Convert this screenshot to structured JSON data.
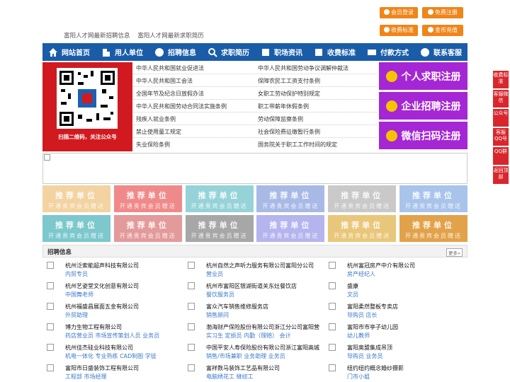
{
  "header": {
    "links": [
      "富阳人才网最新招聘信息",
      "富阳人才网最新求职简历"
    ],
    "buttons": [
      "会员登录",
      "免费注册",
      "收费标准",
      "金币充值"
    ]
  },
  "nav": [
    "网站首页",
    "用人单位",
    "招聘信息",
    "求职简历",
    "职场资讯",
    "收费标准",
    "付款方式",
    "联系客服"
  ],
  "qr_caption": "扫描二维码，关注公众号",
  "laws_left": [
    "中华人民共和国就业促进法",
    "中华人民共和国工会法",
    "全国年节及纪念日放假办法",
    "中华人民共和国劳动合同法实施条例",
    "残疾人就业条例",
    "禁止使用童工规定",
    "失业保险条例"
  ],
  "laws_right": [
    "中华人民共和国劳动争议调解仲裁法",
    "保障农民工工资支付条例",
    "女职工劳动保护特别规定",
    "职工带薪年休假条例",
    "劳动保障监察条例",
    "社会保险费征缴暂行条例",
    "国务院关于职工工作时间的规定"
  ],
  "register": [
    "个人求职注册",
    "企业招聘注册",
    "微信扫码注册"
  ],
  "tile": {
    "line1": "推荐单位",
    "line2": "开通贵宾会员赠送"
  },
  "tile_colors": [
    "#f2d3a1",
    "#f08a8a",
    "#96d3d8",
    "#a9b9e6",
    "#c9c9c9",
    "#a9c4ea",
    "#7cc8cc",
    "#e39a9a",
    "#a7a7a7",
    "#b4b4ee",
    "#e9c77a",
    "#e2a24a"
  ],
  "jobs": {
    "title": "招聘信息",
    "more": "更多»",
    "rows": [
      [
        {
          "name": "杭州泛索能超声科技有限公司",
          "job": "内贸专员"
        },
        {
          "name": "杭州自然之声听力服务有限公司富阳分公司",
          "job": "营业员"
        },
        {
          "name": "杭州富冠房产中介有限公司",
          "job": "房产经纪人"
        }
      ],
      [
        {
          "name": "杭州艺姿堂文化创意有限公司",
          "job": "中国舞老师"
        },
        {
          "name": "杭州市富阳区银湖街道关东灶餐饮店",
          "job": "餐饮服务员"
        },
        {
          "name": "盛康",
          "job": "文员"
        }
      ],
      [
        {
          "name": "杭州福盛昌展面五金有限公司",
          "job": "外贸助理"
        },
        {
          "name": "富众汽车销售维修服务店",
          "job": "销售顾问"
        },
        {
          "name": "富阳柔然整板专卖店",
          "job": "导购员 店长"
        }
      ],
      [
        {
          "name": "博力生物工程有限公司",
          "job": "药店营业员 市场宣传策划人员 业务员"
        },
        {
          "name": "渤海财产保险股份有限公司浙江分公司富阳营",
          "job": "实习生 定损员 内勤（理赔） 会计"
        },
        {
          "name": "富阳市市亭子幼儿园",
          "job": "幼儿教师"
        }
      ],
      [
        {
          "name": "杭州佳杰硅业科技有限公司",
          "job": "机电一体化 专业熟练 CAD制图 学徒"
        },
        {
          "name": "中国平安人寿保险股份有限公司浙江富阳高城",
          "job": "销售/市场兼职 业务助理 业务员"
        },
        {
          "name": "富阳奥盟集成吊顶",
          "job": "导购员 业务员"
        }
      ],
      [
        {
          "name": "富阳市日盛装饰工程有限公司",
          "job": "工程部 市场经理"
        },
        {
          "name": "富祥数马装饰工艺品有限公司",
          "job": "电脑绣花工 缝纫工"
        },
        {
          "name": "纽约纽约概念婚纱摄影",
          "job": "门市小姐"
        }
      ]
    ]
  },
  "side": [
    "收费标准",
    "客服微信",
    "公众号",
    "客服QQ号",
    "QQ群",
    "返回顶部"
  ]
}
